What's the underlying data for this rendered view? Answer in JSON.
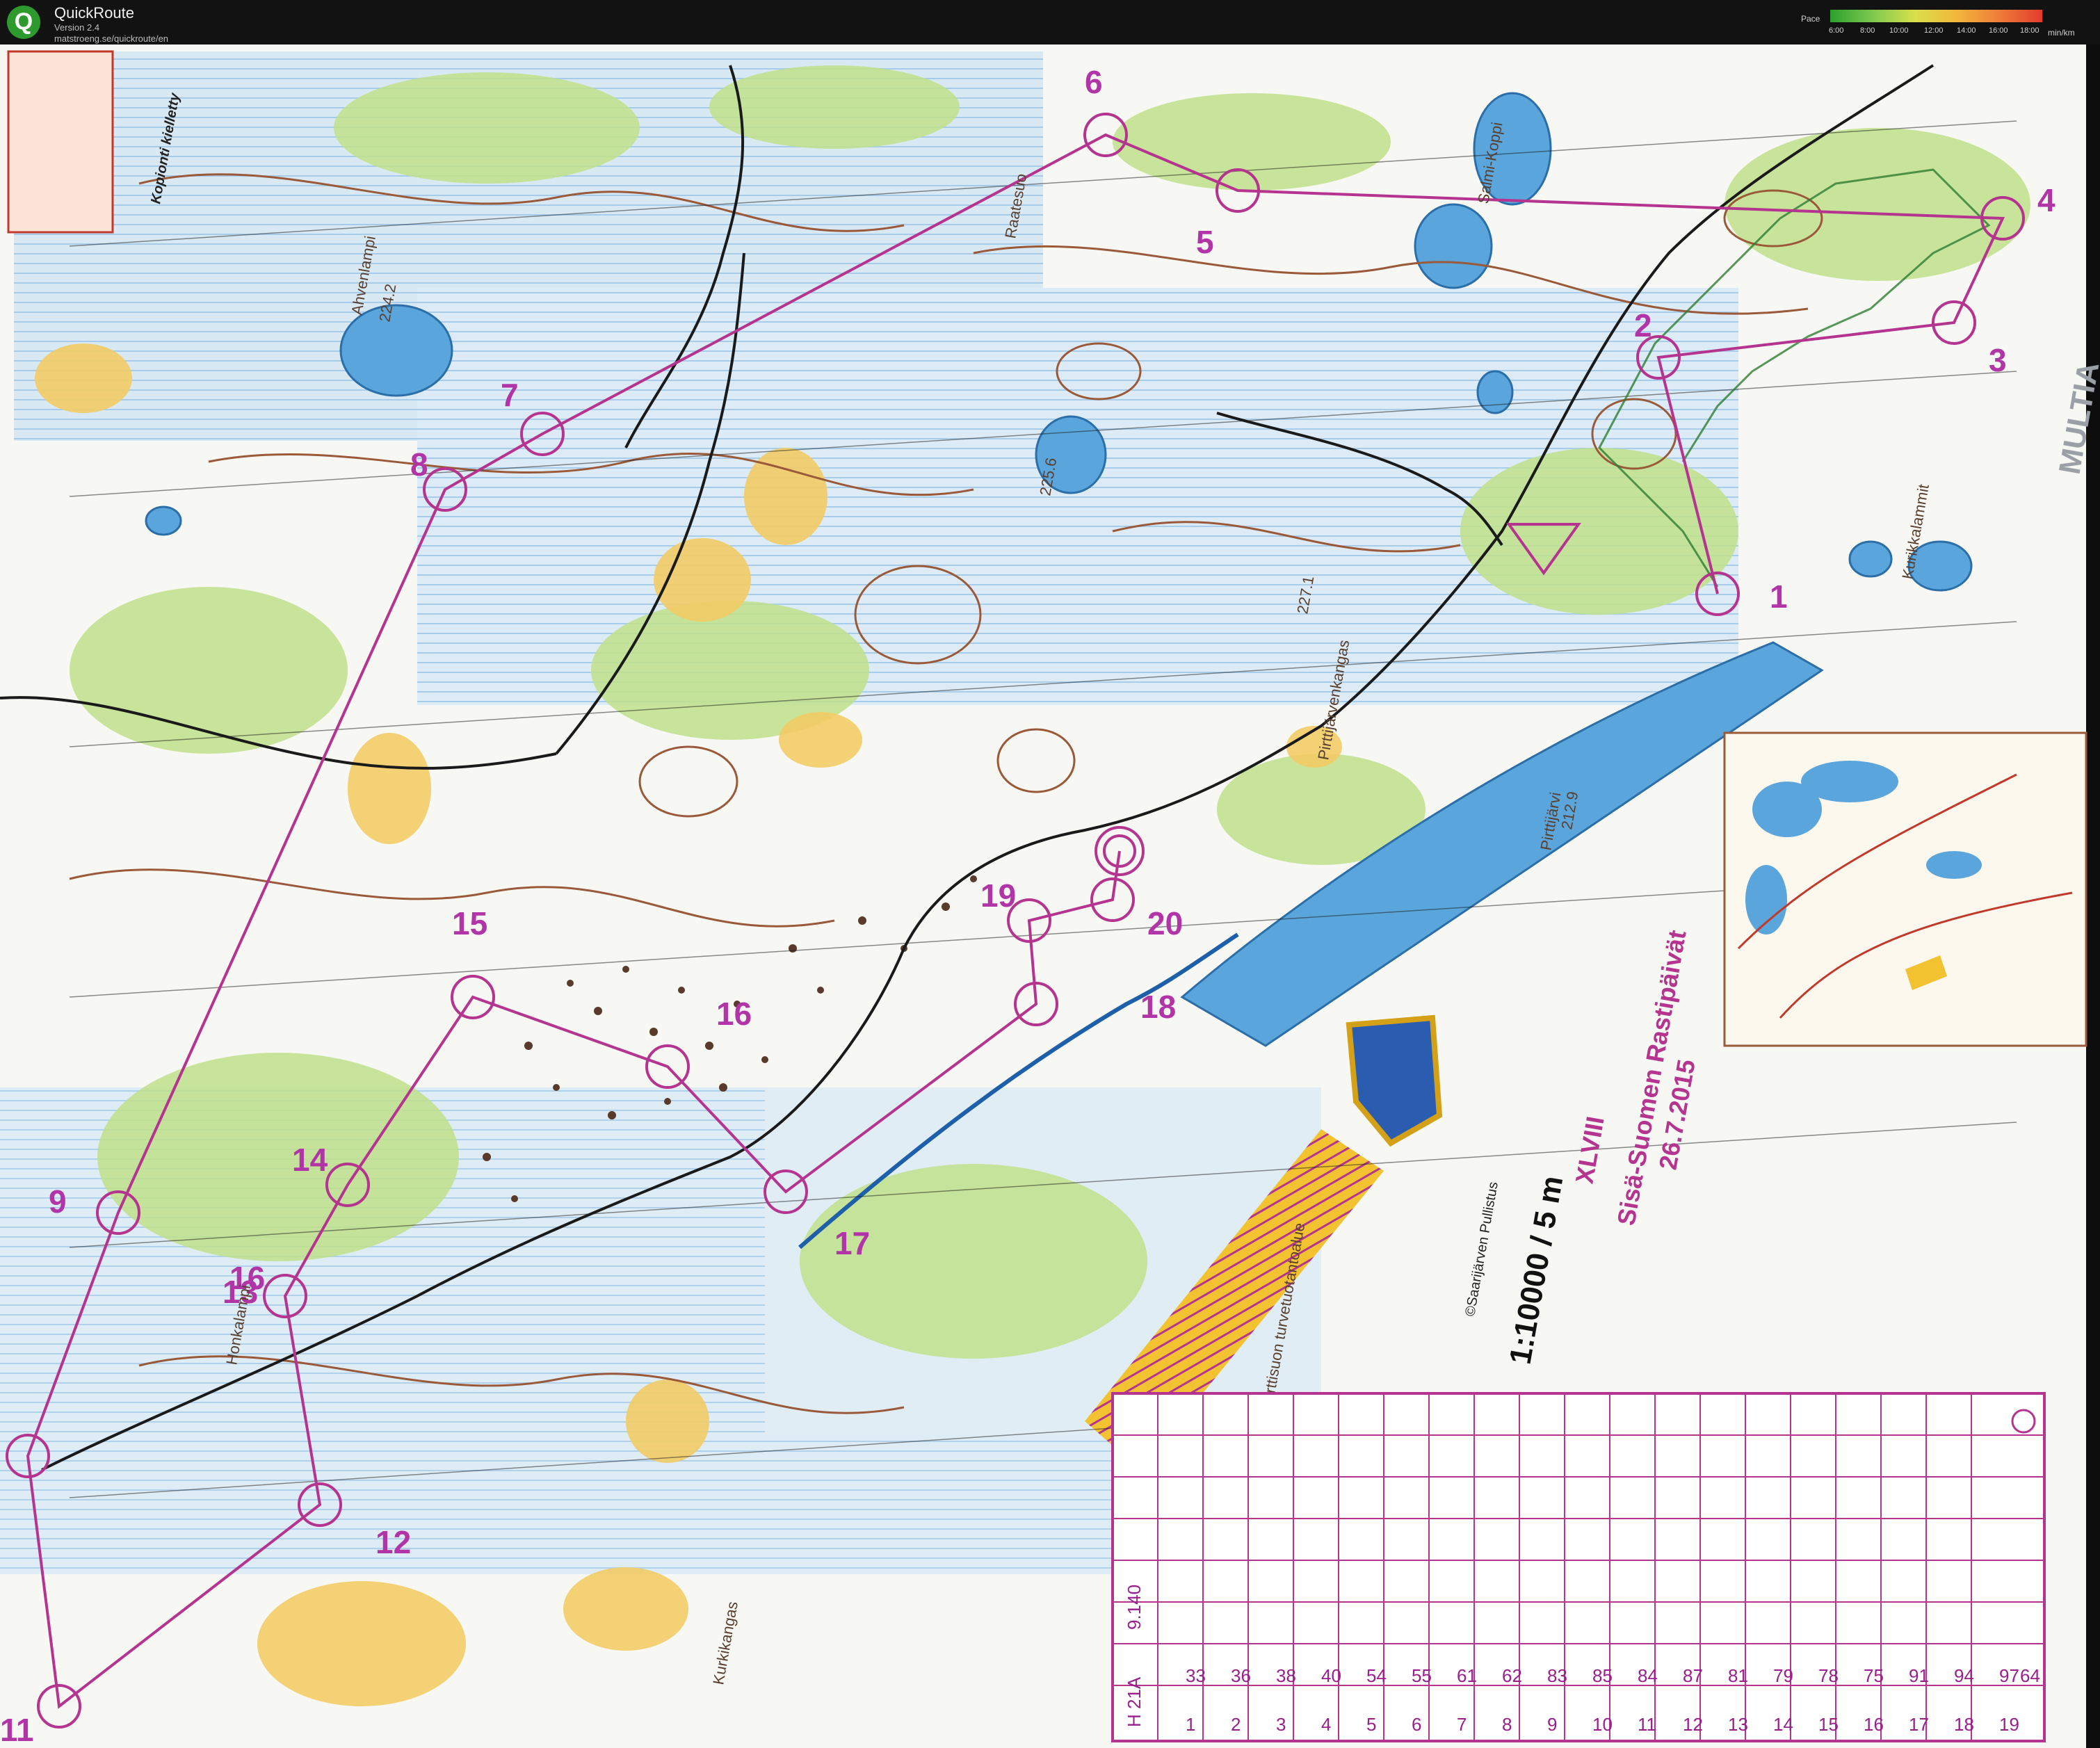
{
  "app": {
    "title": "QuickRoute",
    "version": "Version 2.4",
    "url": "matstroeng.se/quickroute/en",
    "logo_letter": "Q"
  },
  "pace_legend": {
    "label": "Pace",
    "unit": "min/km",
    "ticks": [
      "6:00",
      "8:00",
      "10:00",
      "12:00",
      "14:00",
      "16:00",
      "18:00"
    ]
  },
  "map": {
    "event_name": "Sisä-Suomen Rastipäivät",
    "edition": "XLVIII",
    "date": "26.7.2015",
    "scale": "1:10000 / 5 m",
    "copyright": "©Saarijärven Pullistus",
    "lake_names": [
      "Ahvenlampi",
      "Salmi-Koppi",
      "Pirttijärvi",
      "Honkalampi",
      "Kurikkalammit"
    ],
    "spot_heights": [
      "224.2",
      "225.6",
      "212.9",
      "227.1"
    ],
    "area_names": [
      "Pirttijärvenkangas",
      "Kurkikangas",
      "Pirttisuon turvetuotantoalue",
      "Raatesuo",
      "MULTIA"
    ],
    "notice_title": "Kopionti kielletty",
    "colors": {
      "route": "#b5348f",
      "water": "#5aa6dc",
      "vegetation": "#9bcd5a",
      "open": "#f0c04a",
      "contour": "#9a5a3a"
    }
  },
  "controls": [
    {
      "n": "1",
      "code": "33"
    },
    {
      "n": "2",
      "code": "36"
    },
    {
      "n": "3",
      "code": "38"
    },
    {
      "n": "4",
      "code": "40"
    },
    {
      "n": "5",
      "code": "54"
    },
    {
      "n": "6",
      "code": "55"
    },
    {
      "n": "7",
      "code": "61"
    },
    {
      "n": "8",
      "code": "62"
    },
    {
      "n": "9",
      "code": "83"
    },
    {
      "n": "10",
      "code": "85"
    },
    {
      "n": "11",
      "code": "84"
    },
    {
      "n": "12",
      "code": "87"
    },
    {
      "n": "13",
      "code": "81"
    },
    {
      "n": "14",
      "code": "79"
    },
    {
      "n": "15",
      "code": "78"
    },
    {
      "n": "16",
      "code": "75"
    },
    {
      "n": "17",
      "code": "91"
    },
    {
      "n": "18",
      "code": "94"
    },
    {
      "n": "19",
      "code": "97"
    },
    {
      "n": "20",
      "code": "64"
    }
  ],
  "description_sheet": {
    "class": "H 21A",
    "length": "9.140"
  }
}
